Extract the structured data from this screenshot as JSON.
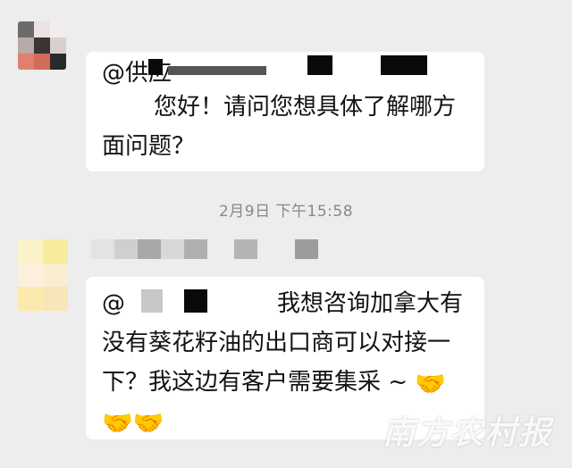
{
  "message1": {
    "sender_partial": "@供应",
    "lines": [
      "您好！请问您想具体了解哪方",
      "面问题？"
    ]
  },
  "timestamp": "2月9日 下午15:58",
  "message2": {
    "mention": "@",
    "lines": [
      "我想咨询加拿大有",
      "没有葵花籽油的出口商可以对接一",
      "下？我这边有客户需要集采 ~"
    ],
    "emoji": "🤝"
  },
  "watermark": "南方农村报",
  "colors": {
    "background": "#ededed",
    "bubble": "#ffffff",
    "time_text": "#888888"
  }
}
